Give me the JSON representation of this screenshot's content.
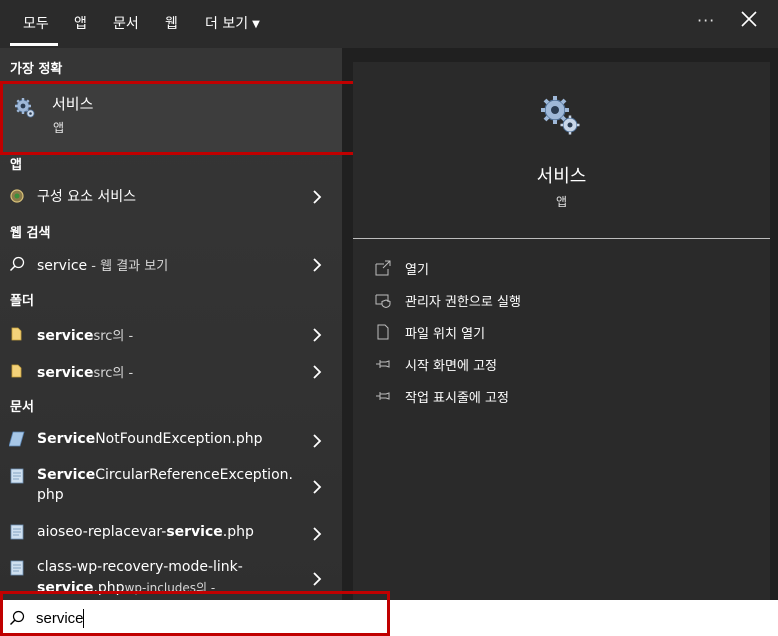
{
  "tabs": [
    {
      "label": "모두",
      "active": true
    },
    {
      "label": "앱"
    },
    {
      "label": "문서"
    },
    {
      "label": "웹"
    },
    {
      "label": "더 보기"
    }
  ],
  "top_actions": {
    "more_icon": "ellipsis-icon",
    "more_text": "···",
    "close_icon": "close-icon"
  },
  "left": {
    "best_match_header": "가장 정확",
    "best_match": {
      "title": "서비스",
      "subtitle": "앱",
      "icon": "gears-icon"
    },
    "apps_header": "앱",
    "apps": [
      {
        "label": "구성 요소 서비스",
        "icon": "component-services-icon"
      }
    ],
    "web_header": "웹 검색",
    "web": [
      {
        "query": "service",
        "suffix": " - 웹 결과 보기",
        "icon": "search-icon"
      }
    ],
    "folders_header": "폴더",
    "folders": [
      {
        "bold": "service",
        "rest": "src의 -",
        "icon": "folder-icon"
      },
      {
        "bold": "service",
        "rest": "src의 -",
        "icon": "folder-icon"
      }
    ],
    "docs_header": "문서",
    "docs": [
      {
        "prefix": "",
        "bold": "Service",
        "rest": "NotFoundException.php",
        "icon": "php-file-icon"
      },
      {
        "prefix": "",
        "bold": "Service",
        "rest": "CircularReferenceException.",
        "line2": "php",
        "icon": "text-file-icon"
      },
      {
        "prefix": "aioseo-replacevar-",
        "bold": "service",
        "rest": ".php",
        "icon": "text-file-icon"
      },
      {
        "prefix": "class-wp-recovery-mode-link-",
        "bold": "service",
        "rest": ".php",
        "dim": "wp-includes의 -",
        "icon": "text-file-icon"
      }
    ]
  },
  "detail": {
    "title": "서비스",
    "subtitle": "앱",
    "icon": "gears-icon",
    "actions": [
      {
        "label": "열기",
        "icon": "open-icon"
      },
      {
        "label": "관리자 권한으로 실행",
        "icon": "run-as-admin-icon"
      },
      {
        "label": "파일 위치 열기",
        "icon": "file-location-icon"
      },
      {
        "label": "시작 화면에 고정",
        "icon": "pin-icon"
      },
      {
        "label": "작업 표시줄에 고정",
        "icon": "pin-icon"
      }
    ]
  },
  "search": {
    "value": "service",
    "icon": "search-icon"
  },
  "colors": {
    "highlight_frame": "#c00000",
    "background": "#202020",
    "best_match_bg": "#3d3d3d"
  }
}
